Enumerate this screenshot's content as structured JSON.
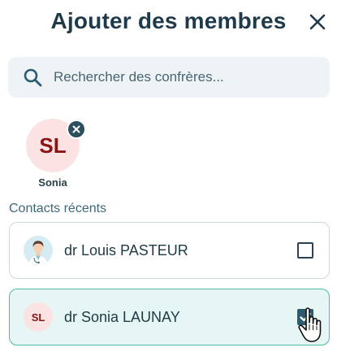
{
  "header": {
    "title": "Ajouter des membres",
    "close_icon": "close-icon"
  },
  "search": {
    "placeholder": "Rechercher des confrères...",
    "value": "",
    "icon": "search-icon"
  },
  "selected_members": [
    {
      "initials": "SL",
      "name": "Sonia",
      "avatar_bg": "#fbe3e3",
      "initials_color": "#8b1414"
    }
  ],
  "recent_contacts": {
    "label": "Contacts récents",
    "items": [
      {
        "name": "dr Louis PASTEUR",
        "avatar": "doctor-photo",
        "checked": false
      },
      {
        "name": "dr Sonia LAUNAY",
        "initials": "SL",
        "checked": true
      }
    ]
  },
  "colors": {
    "title": "#1f3a4a",
    "accent_teal": "#4fb8aa",
    "selected_row_bg": "#e6f6f4",
    "checkbox_checked": "#2c5a6e",
    "search_bg": "#eef4f6"
  }
}
